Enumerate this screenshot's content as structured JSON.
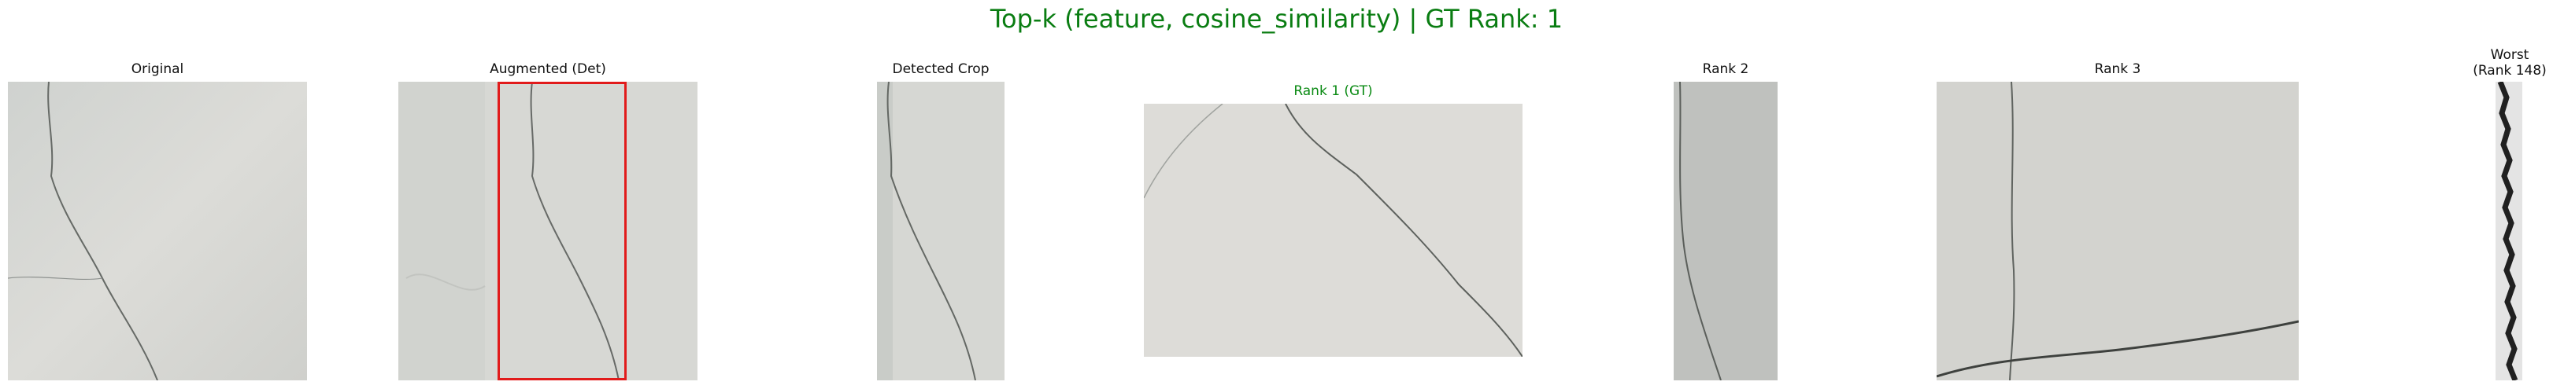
{
  "title": "Top-k (feature, cosine_similarity) | GT Rank: 1",
  "panels": {
    "original": "Original",
    "augmented": "Augmented (Det)",
    "detected": "Detected Crop",
    "rank1": "Rank 1 (GT)",
    "rank2": "Rank 2",
    "rank3": "Rank 3",
    "worst_line1": "Worst",
    "worst_line2": "(Rank 148)"
  },
  "colors": {
    "title": "#0a7d12",
    "gt_label": "#0a8a13",
    "detection_box": "#e11b1b"
  }
}
